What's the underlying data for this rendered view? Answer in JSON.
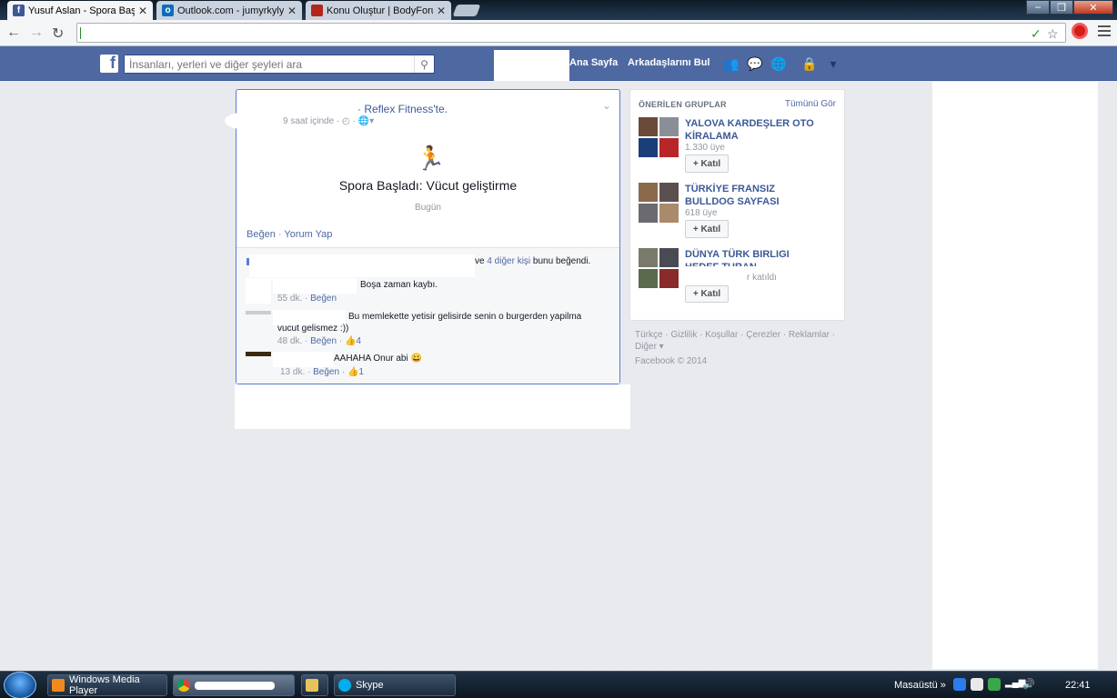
{
  "browser": {
    "tabs": [
      {
        "title": "Yusuf Aslan - Spora Başlad",
        "active": true,
        "favicon": "facebook-favicon"
      },
      {
        "title": "Outlook.com - jumyrkyly",
        "active": false,
        "favicon": "outlook-favicon"
      },
      {
        "title": "Konu Oluştur | BodyForum",
        "active": false,
        "favicon": "bodyforum-favicon"
      }
    ],
    "tab_close": "✕",
    "address": ""
  },
  "facebook": {
    "logo": "f",
    "search_placeholder": "İnsanları, yerleri ve diğer şeyleri ara",
    "nav": {
      "home": "Ana Sayfa",
      "find_friends": "Arkadaşlarını Bul"
    }
  },
  "story": {
    "author_suffix": "· Reflex Fitness'te.",
    "meta": "9 saat içinde · ◴ · 🌐▾",
    "activity_icon": "running-person-icon",
    "activity_title": "Spora Başladı: Vücut geliştirme",
    "activity_date": "Bugün",
    "actions": {
      "like": "Beğen",
      "sep": " · ",
      "comment": "Yorum Yap"
    },
    "likes": {
      "prefix": "ve ",
      "others": "4 diğer kişi",
      "suffix": " bunu beğendi."
    },
    "comments": [
      {
        "text": "Boşa zaman kaybı.",
        "time": "55 dk.",
        "like": "Beğen",
        "likes": ""
      },
      {
        "text": "Bu memlekette yetisir gelisirde senin o burgerden yapilma",
        "text2": "vucut gelismez :))",
        "time": "48 dk.",
        "like": "Beğen",
        "likes": "4"
      },
      {
        "text": "AAHAHA Onur abi",
        "emoji": "😀",
        "time": "13 dk.",
        "like": "Beğen",
        "likes": "1"
      }
    ]
  },
  "groups": {
    "title": "ÖNERİLEN GRUPLAR",
    "see_all": "Tümünü Gör",
    "join_label": "+ Katıl",
    "items": [
      {
        "name": "YALOVA KARDEŞLER OTO KİRALAMA",
        "members": "1.330 üye"
      },
      {
        "name": "TÜRKİYE FRANSIZ BULLDOG SAYFASI",
        "members": "618 üye"
      },
      {
        "name": "DÜNYA TÜRK BIRLIGI HEDEF TURAN",
        "members": "r katıldı"
      }
    ]
  },
  "footer": {
    "links": "Türkçe · Gizlilik · Koşullar · Çerezler · Reklamlar · Diğer ▾",
    "copyright": "Facebook © 2014"
  },
  "taskbar": {
    "items": [
      "Windows Media Player",
      "",
      "",
      "Skype"
    ],
    "desktop_label": "Masaüstü",
    "clock": "22:41"
  },
  "colors": {
    "facebook_blue": "#4e69a2",
    "link": "#4e69a2",
    "page_bg": "#e9eaed"
  }
}
